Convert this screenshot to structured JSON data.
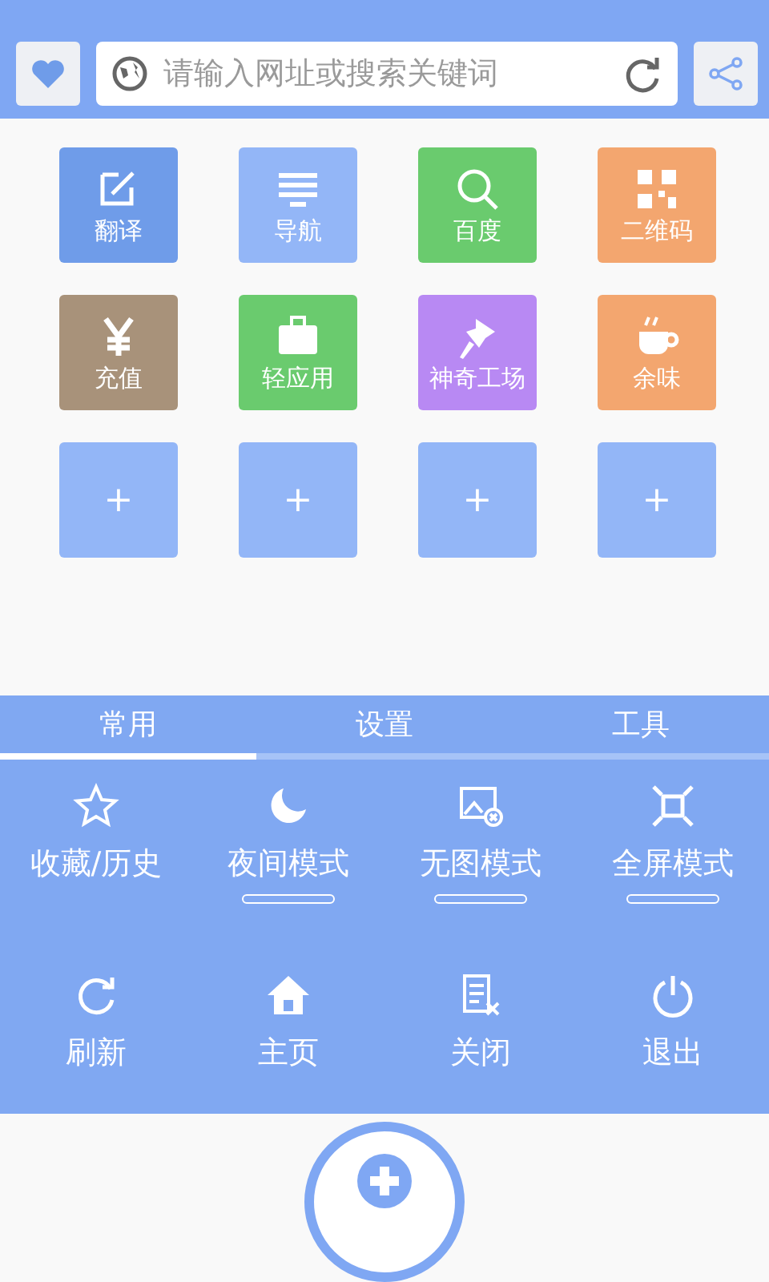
{
  "address_bar": {
    "placeholder": "请输入网址或搜索关键词"
  },
  "shortcuts": [
    {
      "kind": "app",
      "label": "翻译",
      "color": "#6f9ce9"
    },
    {
      "kind": "app",
      "label": "导航",
      "color": "#93b6f7"
    },
    {
      "kind": "app",
      "label": "百度",
      "color": "#6acb6e"
    },
    {
      "kind": "app",
      "label": "二维码",
      "color": "#f3a66f"
    },
    {
      "kind": "app",
      "label": "充值",
      "color": "#a8927a"
    },
    {
      "kind": "app",
      "label": "轻应用",
      "color": "#6acb6e"
    },
    {
      "kind": "app",
      "label": "神奇工场",
      "color": "#b889f3"
    },
    {
      "kind": "app",
      "label": "余味",
      "color": "#f3a66f"
    },
    {
      "kind": "add",
      "label": "+",
      "color": "#93b6f7"
    },
    {
      "kind": "add",
      "label": "+",
      "color": "#93b6f7"
    },
    {
      "kind": "add",
      "label": "+",
      "color": "#93b6f7"
    },
    {
      "kind": "add",
      "label": "+",
      "color": "#93b6f7"
    }
  ],
  "menu_tabs": [
    {
      "label": "常用",
      "selected": true
    },
    {
      "label": "设置",
      "selected": false
    },
    {
      "label": "工具",
      "selected": false
    }
  ],
  "menu_items": [
    {
      "kind": "action",
      "label": "收藏/历史"
    },
    {
      "kind": "toggle",
      "label": "夜间模式",
      "on": false
    },
    {
      "kind": "toggle",
      "label": "无图模式",
      "on": false
    },
    {
      "kind": "toggle",
      "label": "全屏模式",
      "on": false
    },
    {
      "kind": "action",
      "label": "刷新"
    },
    {
      "kind": "action",
      "label": "主页"
    },
    {
      "kind": "action",
      "label": "关闭"
    },
    {
      "kind": "action",
      "label": "退出"
    }
  ]
}
